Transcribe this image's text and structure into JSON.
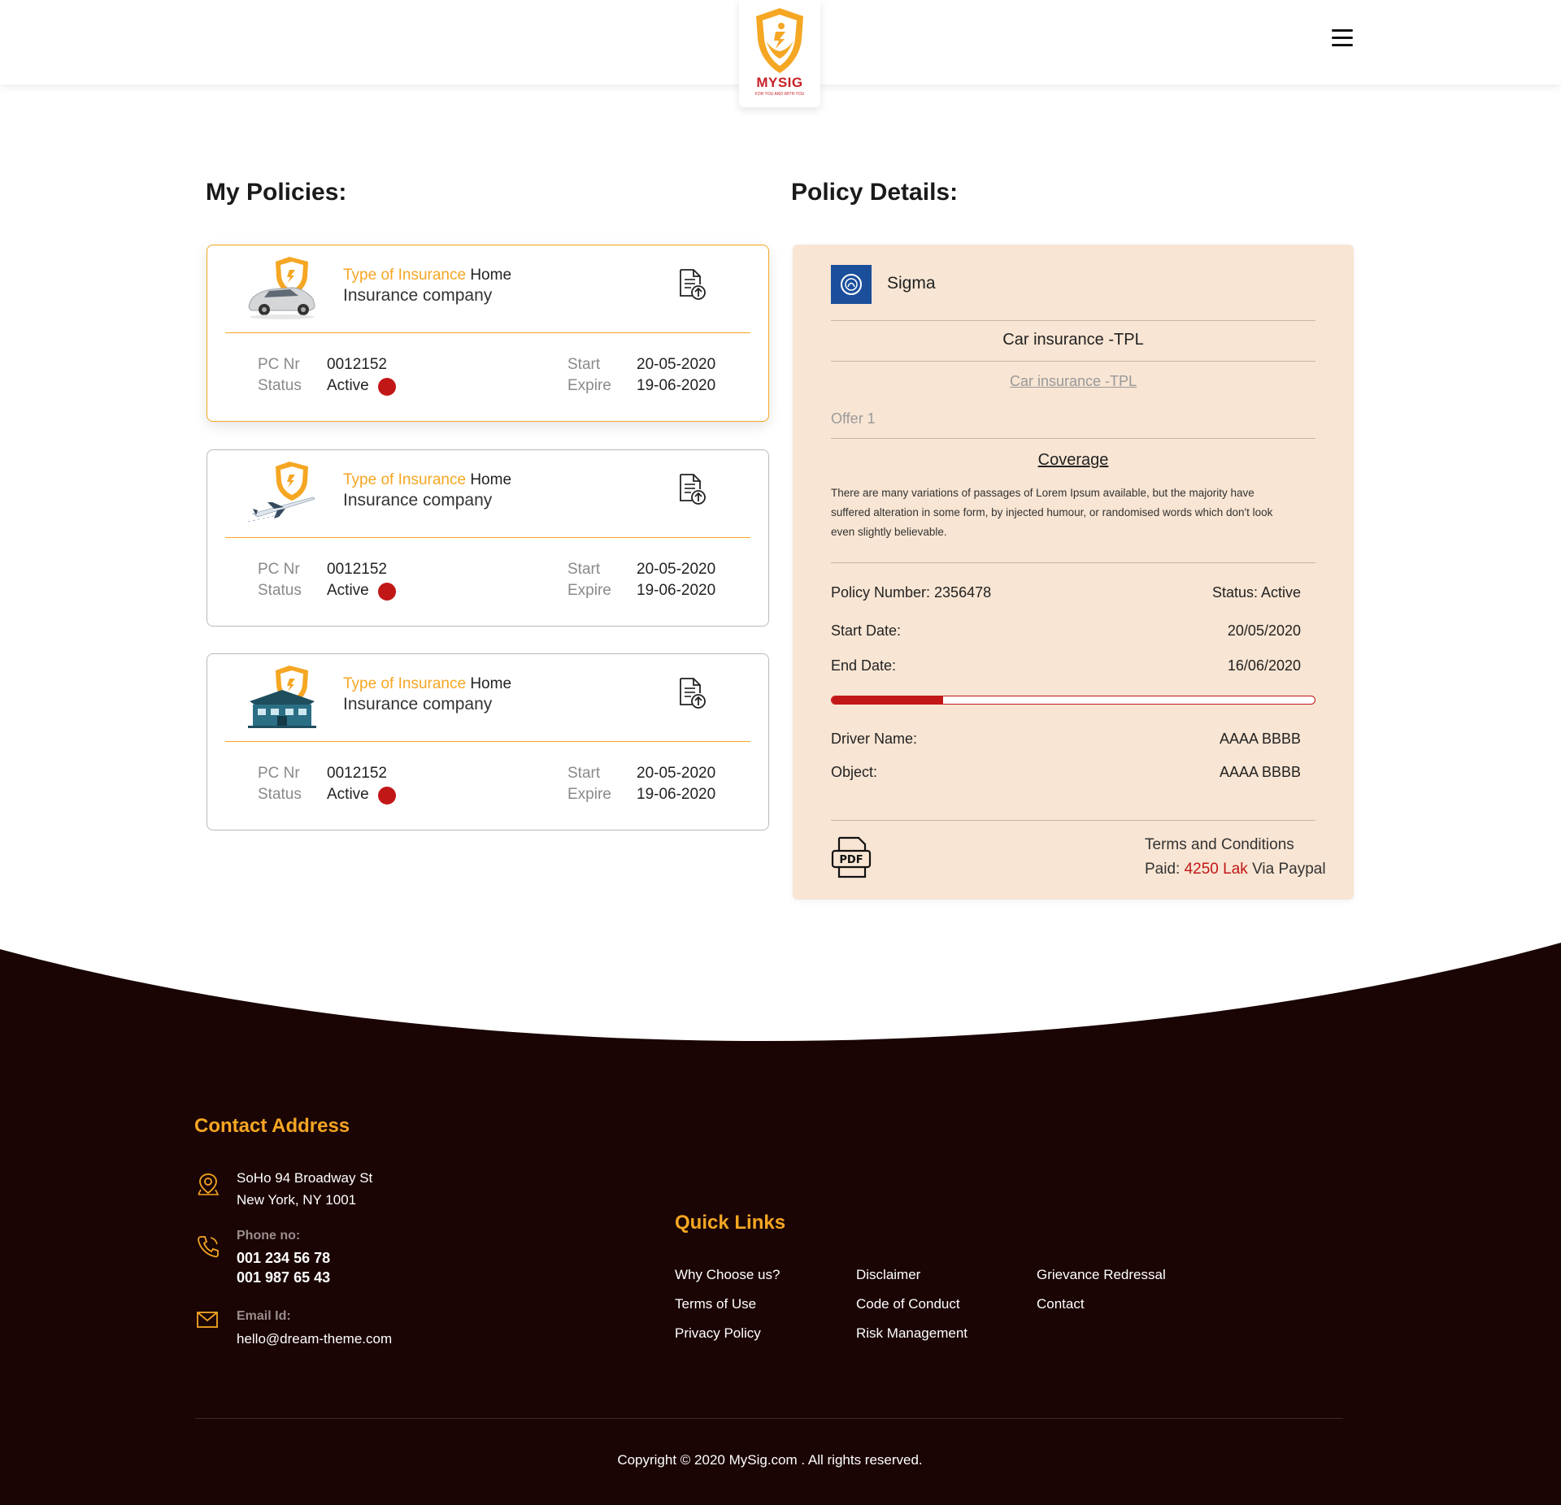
{
  "brand": {
    "name": "MYSIG",
    "tagline": "FOR YOU AND WITH YOU"
  },
  "menu_icon": "hamburger-menu-icon",
  "policies_title": "My Policies:",
  "details_title": "Policy Details:",
  "policies": [
    {
      "thumb": "car",
      "type_label": "Type of Insurance",
      "type_value": "Home",
      "company": "Insurance company",
      "pc_label": "PC Nr",
      "pc_value": "0012152",
      "status_label": "Status",
      "status_value": "Active",
      "start_label": "Start",
      "start_value": "20-05-2020",
      "expire_label": "Expire",
      "expire_value": "19-06-2020"
    },
    {
      "thumb": "plane",
      "type_label": "Type of Insurance",
      "type_value": "Home",
      "company": "Insurance company",
      "pc_label": "PC Nr",
      "pc_value": "0012152",
      "status_label": "Status",
      "status_value": "Active",
      "start_label": "Start",
      "start_value": "20-05-2020",
      "expire_label": "Expire",
      "expire_value": "19-06-2020"
    },
    {
      "thumb": "house",
      "type_label": "Type of Insurance",
      "type_value": "Home",
      "company": "Insurance company",
      "pc_label": "PC Nr",
      "pc_value": "0012152",
      "status_label": "Status",
      "status_value": "Active",
      "start_label": "Start",
      "start_value": "20-05-2020",
      "expire_label": "Expire",
      "expire_value": "19-06-2020"
    }
  ],
  "details": {
    "company": "Sigma",
    "product": "Car insurance -TPL",
    "product_link": "Car insurance -TPL",
    "offer": "Offer 1",
    "coverage_title": "Coverage",
    "coverage_text": "There are many variations of passages of Lorem Ipsum available, but the majority have suffered alteration in some form, by injected humour, or randomised words which don't look even slightly believable.",
    "policy_number": "Policy Number: 2356478",
    "status": "Status: Active",
    "start_label": "Start Date:",
    "start_value": "20/05/2020",
    "end_label": "End Date:",
    "end_value": "16/06/2020",
    "progress_fraction": 0.23,
    "driver_label": "Driver Name:",
    "driver_value": "AAAA BBBB",
    "object_label": "Object:",
    "object_value": "AAAA BBBB",
    "terms": "Terms and Conditions",
    "paid_prefix": "Paid:",
    "paid_amount": "4250 Lak",
    "paid_suffix": "Via Paypal"
  },
  "footer": {
    "contact_title": "Contact Address",
    "address_line1": "SoHo 94 Broadway St",
    "address_line2": "New York, NY 1001",
    "phone_label": "Phone no:",
    "phone1": "001 234 56 78",
    "phone2": "001 987 65 43",
    "email_label": "Email Id:",
    "email": "hello@dream-theme.com",
    "quick_links_title": "Quick Links",
    "links": [
      "Why Choose us?",
      "Terms of Use",
      "Privacy Policy",
      "Disclaimer",
      "Code of Conduct",
      "Risk Management",
      "Grievance Redressal",
      "Contact"
    ],
    "copyright": "Copyright © 2020 MySig.com . All rights reserved."
  },
  "colors": {
    "accent": "#f5a623",
    "danger": "#c21717",
    "panel": "#f8e5d3",
    "footer": "#1a0404"
  }
}
